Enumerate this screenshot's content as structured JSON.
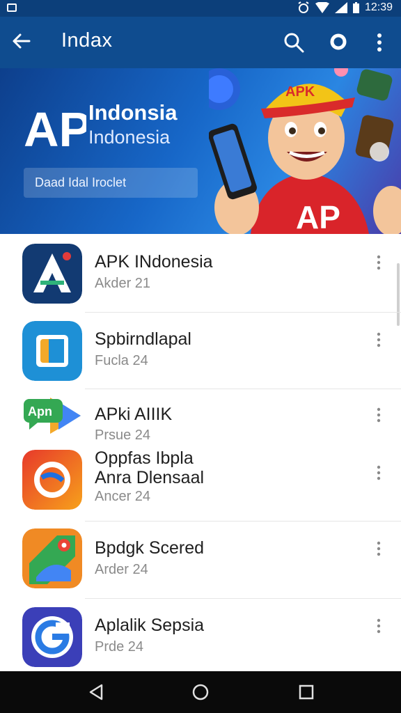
{
  "status": {
    "time": "12:39"
  },
  "appbar": {
    "title": "Indax"
  },
  "banner": {
    "logo_text": "AP",
    "title": "Indonsia",
    "subtitle": "Indonesia",
    "button_label": "Daad Idal Iroclet",
    "mascot_cap": "APK",
    "mascot_shirt": "AP"
  },
  "apps": [
    {
      "name": "APK INdonesia",
      "meta": "Akder 21"
    },
    {
      "name": "Spbirndlapal",
      "meta": "Fucla 24"
    },
    {
      "name": "APki AIIIK",
      "meta": "Prsue 24",
      "badge": "Apn"
    },
    {
      "name": "Oppfas Ibpla",
      "name2": "Anra Dlensaal",
      "meta": "Ancer 24"
    },
    {
      "name": "Bpdgk Scered",
      "meta": "Arder 24"
    },
    {
      "name": "Aplalik Sepsia",
      "meta": "Prde 24"
    }
  ],
  "colors": {
    "appbar": "#0f4c8f",
    "status": "#0c3f7a",
    "nav": "#0a0a0a"
  }
}
